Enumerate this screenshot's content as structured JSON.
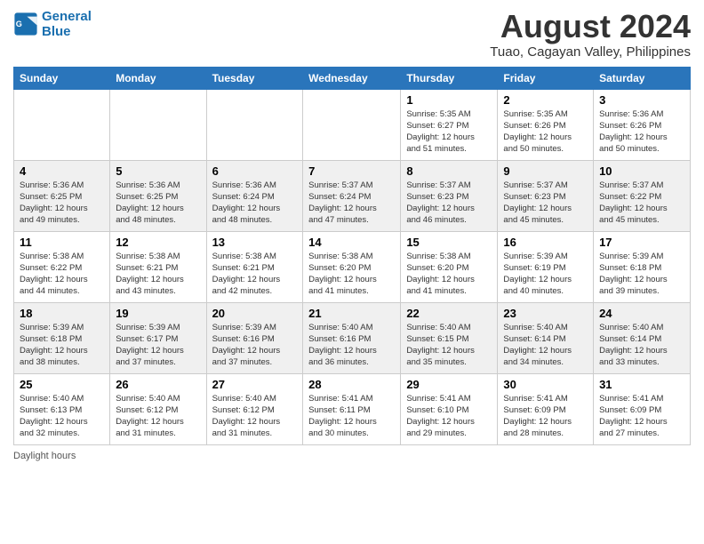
{
  "header": {
    "logo_line1": "General",
    "logo_line2": "Blue",
    "main_title": "August 2024",
    "subtitle": "Tuao, Cagayan Valley, Philippines"
  },
  "days_of_week": [
    "Sunday",
    "Monday",
    "Tuesday",
    "Wednesday",
    "Thursday",
    "Friday",
    "Saturday"
  ],
  "weeks": [
    [
      {
        "day": "",
        "content": ""
      },
      {
        "day": "",
        "content": ""
      },
      {
        "day": "",
        "content": ""
      },
      {
        "day": "",
        "content": ""
      },
      {
        "day": "1",
        "content": "Sunrise: 5:35 AM\nSunset: 6:27 PM\nDaylight: 12 hours\nand 51 minutes."
      },
      {
        "day": "2",
        "content": "Sunrise: 5:35 AM\nSunset: 6:26 PM\nDaylight: 12 hours\nand 50 minutes."
      },
      {
        "day": "3",
        "content": "Sunrise: 5:36 AM\nSunset: 6:26 PM\nDaylight: 12 hours\nand 50 minutes."
      }
    ],
    [
      {
        "day": "4",
        "content": "Sunrise: 5:36 AM\nSunset: 6:25 PM\nDaylight: 12 hours\nand 49 minutes."
      },
      {
        "day": "5",
        "content": "Sunrise: 5:36 AM\nSunset: 6:25 PM\nDaylight: 12 hours\nand 48 minutes."
      },
      {
        "day": "6",
        "content": "Sunrise: 5:36 AM\nSunset: 6:24 PM\nDaylight: 12 hours\nand 48 minutes."
      },
      {
        "day": "7",
        "content": "Sunrise: 5:37 AM\nSunset: 6:24 PM\nDaylight: 12 hours\nand 47 minutes."
      },
      {
        "day": "8",
        "content": "Sunrise: 5:37 AM\nSunset: 6:23 PM\nDaylight: 12 hours\nand 46 minutes."
      },
      {
        "day": "9",
        "content": "Sunrise: 5:37 AM\nSunset: 6:23 PM\nDaylight: 12 hours\nand 45 minutes."
      },
      {
        "day": "10",
        "content": "Sunrise: 5:37 AM\nSunset: 6:22 PM\nDaylight: 12 hours\nand 45 minutes."
      }
    ],
    [
      {
        "day": "11",
        "content": "Sunrise: 5:38 AM\nSunset: 6:22 PM\nDaylight: 12 hours\nand 44 minutes."
      },
      {
        "day": "12",
        "content": "Sunrise: 5:38 AM\nSunset: 6:21 PM\nDaylight: 12 hours\nand 43 minutes."
      },
      {
        "day": "13",
        "content": "Sunrise: 5:38 AM\nSunset: 6:21 PM\nDaylight: 12 hours\nand 42 minutes."
      },
      {
        "day": "14",
        "content": "Sunrise: 5:38 AM\nSunset: 6:20 PM\nDaylight: 12 hours\nand 41 minutes."
      },
      {
        "day": "15",
        "content": "Sunrise: 5:38 AM\nSunset: 6:20 PM\nDaylight: 12 hours\nand 41 minutes."
      },
      {
        "day": "16",
        "content": "Sunrise: 5:39 AM\nSunset: 6:19 PM\nDaylight: 12 hours\nand 40 minutes."
      },
      {
        "day": "17",
        "content": "Sunrise: 5:39 AM\nSunset: 6:18 PM\nDaylight: 12 hours\nand 39 minutes."
      }
    ],
    [
      {
        "day": "18",
        "content": "Sunrise: 5:39 AM\nSunset: 6:18 PM\nDaylight: 12 hours\nand 38 minutes."
      },
      {
        "day": "19",
        "content": "Sunrise: 5:39 AM\nSunset: 6:17 PM\nDaylight: 12 hours\nand 37 minutes."
      },
      {
        "day": "20",
        "content": "Sunrise: 5:39 AM\nSunset: 6:16 PM\nDaylight: 12 hours\nand 37 minutes."
      },
      {
        "day": "21",
        "content": "Sunrise: 5:40 AM\nSunset: 6:16 PM\nDaylight: 12 hours\nand 36 minutes."
      },
      {
        "day": "22",
        "content": "Sunrise: 5:40 AM\nSunset: 6:15 PM\nDaylight: 12 hours\nand 35 minutes."
      },
      {
        "day": "23",
        "content": "Sunrise: 5:40 AM\nSunset: 6:14 PM\nDaylight: 12 hours\nand 34 minutes."
      },
      {
        "day": "24",
        "content": "Sunrise: 5:40 AM\nSunset: 6:14 PM\nDaylight: 12 hours\nand 33 minutes."
      }
    ],
    [
      {
        "day": "25",
        "content": "Sunrise: 5:40 AM\nSunset: 6:13 PM\nDaylight: 12 hours\nand 32 minutes."
      },
      {
        "day": "26",
        "content": "Sunrise: 5:40 AM\nSunset: 6:12 PM\nDaylight: 12 hours\nand 31 minutes."
      },
      {
        "day": "27",
        "content": "Sunrise: 5:40 AM\nSunset: 6:12 PM\nDaylight: 12 hours\nand 31 minutes."
      },
      {
        "day": "28",
        "content": "Sunrise: 5:41 AM\nSunset: 6:11 PM\nDaylight: 12 hours\nand 30 minutes."
      },
      {
        "day": "29",
        "content": "Sunrise: 5:41 AM\nSunset: 6:10 PM\nDaylight: 12 hours\nand 29 minutes."
      },
      {
        "day": "30",
        "content": "Sunrise: 5:41 AM\nSunset: 6:09 PM\nDaylight: 12 hours\nand 28 minutes."
      },
      {
        "day": "31",
        "content": "Sunrise: 5:41 AM\nSunset: 6:09 PM\nDaylight: 12 hours\nand 27 minutes."
      }
    ]
  ],
  "footer": {
    "note": "Daylight hours"
  }
}
